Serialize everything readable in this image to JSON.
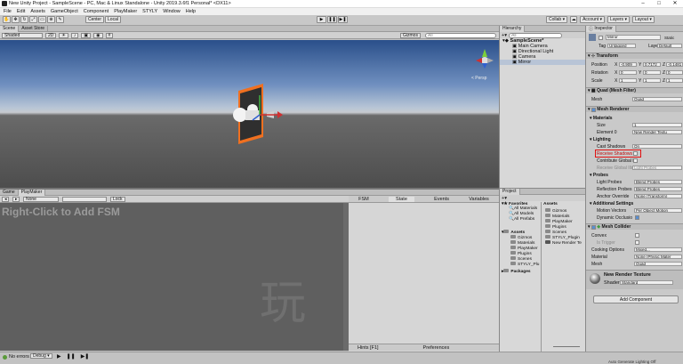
{
  "window": {
    "title": "New Unity Project - SampleScene - PC, Mac & Linux Standalone - Unity 2019.3.6f1 Personal* <DX11>"
  },
  "menu": [
    "File",
    "Edit",
    "Assets",
    "GameObject",
    "Component",
    "PlayMaker",
    "STYLY",
    "Window",
    "Help"
  ],
  "toolbar": {
    "pivot": "Center",
    "space": "Local",
    "collab": "Collab ▾",
    "account": "Account ▾",
    "layers": "Layers ▾",
    "layout": "Layout ▾"
  },
  "scene": {
    "tabs": [
      "Scene",
      "Asset Store"
    ],
    "shading": "Shaded",
    "mode2d": "2D",
    "gizmos": "Gizmos",
    "search_placeholder": "All",
    "persp": "< Persp"
  },
  "game": {
    "tabs": [
      "Game",
      "PlayMaker"
    ],
    "none": "None",
    "lock": "Lock",
    "hint": "Right-Click to Add FSM",
    "watermark": "玩",
    "fsm_tabs": [
      "FSM",
      "State",
      "Events",
      "Variables"
    ],
    "hints_label": "Hints [F1]",
    "prefs_label": "Preferences"
  },
  "hierarchy": {
    "title": "Hierarchy",
    "search": "All",
    "scene": "SampleScene*",
    "items": [
      "Main Camera",
      "Directional Light",
      "Camera",
      "Mirror"
    ]
  },
  "project": {
    "title": "Project",
    "favorites_label": "Favorites",
    "favorites": [
      "All Materials",
      "All Models",
      "All Prefabs"
    ],
    "assets_label": "Assets",
    "tree": [
      "Gizmos",
      "Materials",
      "PlayMaker",
      "Plugins",
      "Scenes",
      "STYLY_Plu"
    ],
    "packages_label": "Packages",
    "right_header": "Assets",
    "right_items": [
      "Gizmos",
      "Materials",
      "PlayMaker",
      "Plugins",
      "Scenes",
      "STYLY_Plugin",
      "New Render Te"
    ]
  },
  "inspector": {
    "title": "Inspector",
    "object_name": "Mirror",
    "static_label": "Static",
    "tag_label": "Tag",
    "tag_value": "Untagged",
    "layer_label": "Layer",
    "layer_value": "Default",
    "transform": {
      "title": "Transform",
      "position_label": "Position",
      "rotation_label": "Rotation",
      "scale_label": "Scale",
      "x": "X",
      "y": "Y",
      "z": "Z",
      "position": [
        "-0.909",
        "0.7172",
        "-0.1481"
      ],
      "rotation": [
        "0",
        "0",
        "0"
      ],
      "scale": [
        "1",
        "1",
        "1"
      ]
    },
    "meshfilter": {
      "title": "Quad (Mesh Filter)",
      "mesh_label": "Mesh",
      "mesh_value": "Quad"
    },
    "renderer": {
      "title": "Mesh Renderer",
      "materials_label": "Materials",
      "size_label": "Size",
      "size_value": "1",
      "element_label": "Element 0",
      "element_value": "New Render Textu",
      "lighting_label": "Lighting",
      "cast_label": "Cast Shadows",
      "cast_value": "On",
      "receive_label": "Receive Shadows",
      "gi_label": "Contribute Global I",
      "receive_gi_label": "Receive Global Illu",
      "receive_gi_value": "Light Probes",
      "probes_label": "Probes",
      "light_probes_label": "Light Probes",
      "light_probes_value": "Blend Probes",
      "reflection_label": "Reflection Probes",
      "reflection_value": "Blend Probes",
      "anchor_label": "Anchor Override",
      "anchor_value": "None (Transform)",
      "additional_label": "Additional Settings",
      "motion_label": "Motion Vectors",
      "motion_value": "Per Object Motion",
      "occlusion_label": "Dynamic Occlusio"
    },
    "collider": {
      "title": "Mesh Collider",
      "convex_label": "Convex",
      "trigger_label": "Is Trigger",
      "cooking_label": "Cooking Options",
      "cooking_value": "Mixed...",
      "material_label": "Material",
      "material_value": "None (Physic Mater",
      "mesh_label": "Mesh",
      "mesh_value": "Quad"
    },
    "material": {
      "name": "New Render Texture",
      "shader_label": "Shader",
      "shader_value": "Standard"
    },
    "add_component": "Add Component"
  },
  "status": {
    "errors": "No errors",
    "debug": "Debug ▾",
    "auto": "Auto Generate Lighting Off"
  }
}
